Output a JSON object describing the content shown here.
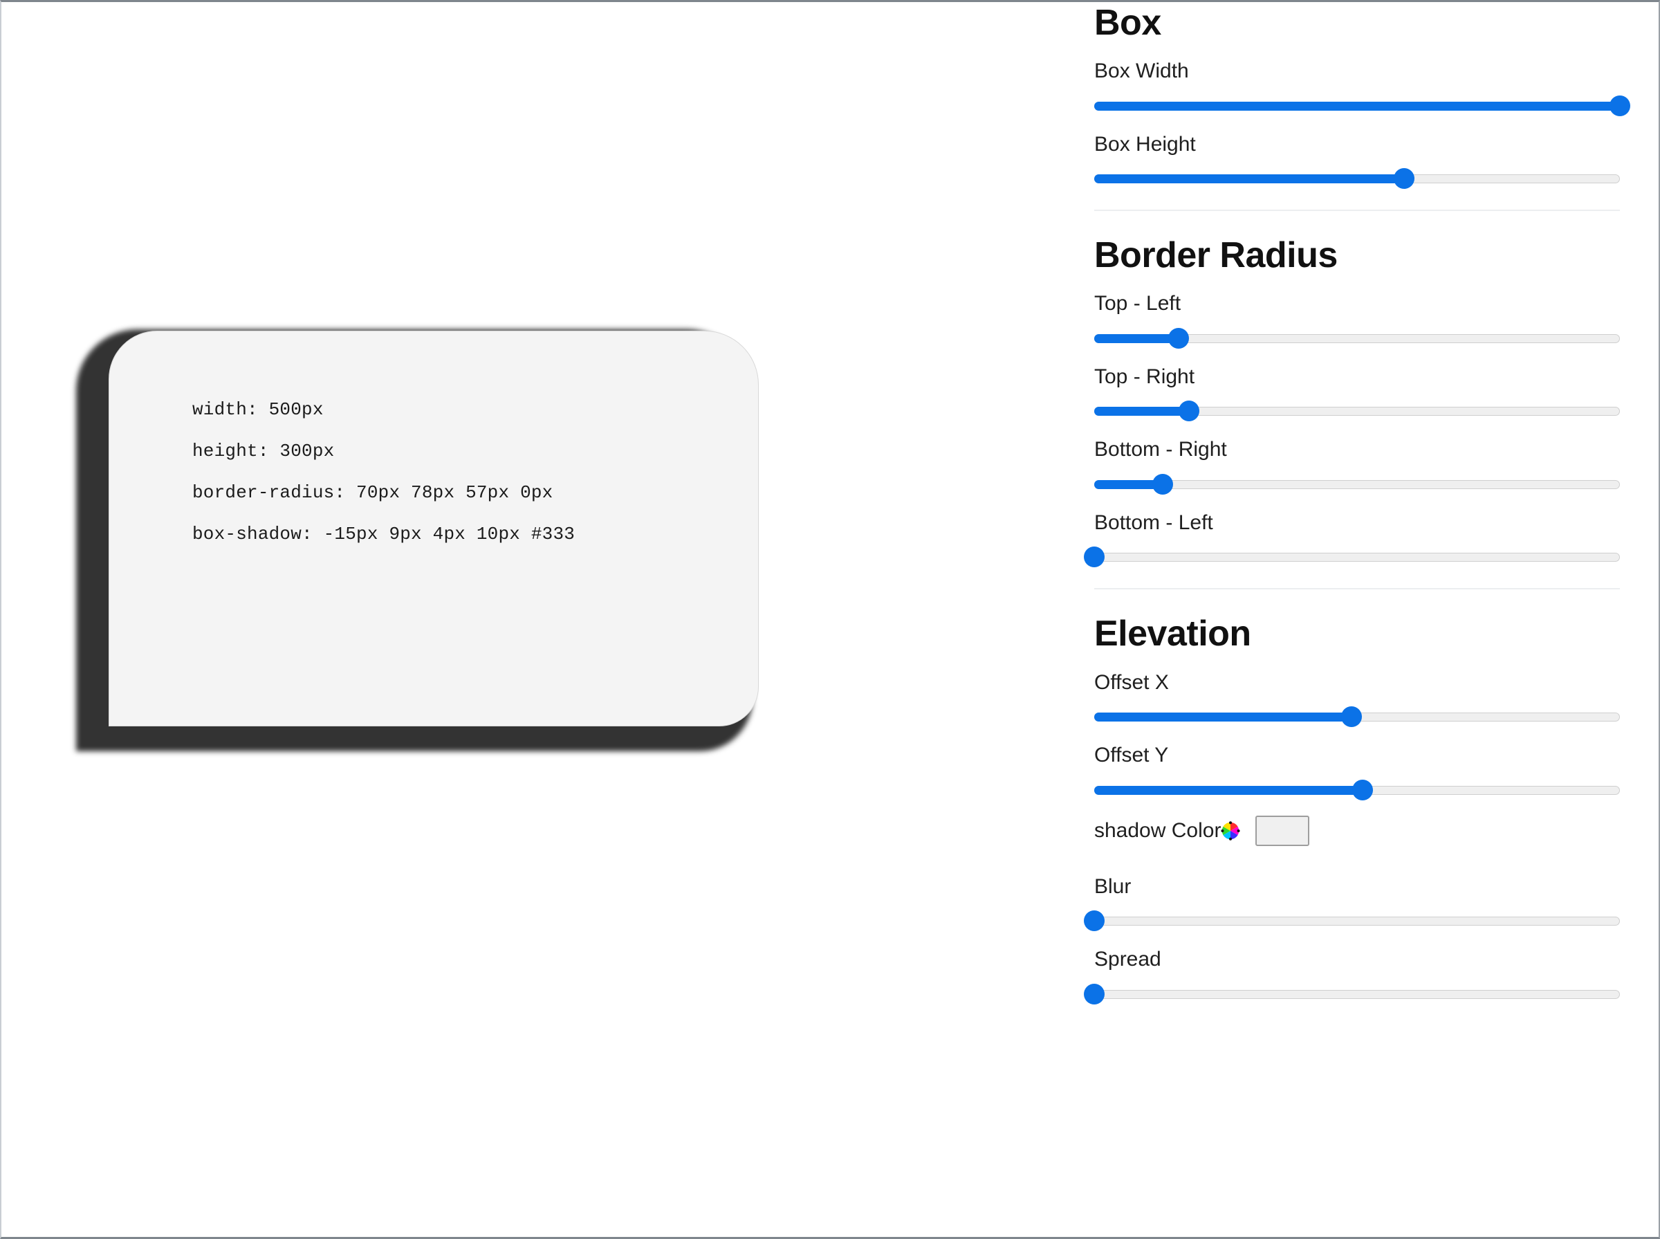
{
  "preview": {
    "code_lines": [
      "width: 500px",
      "height: 300px",
      "border-radius: 70px 78px 57px 0px",
      "box-shadow: -15px 9px 4px 10px #333"
    ],
    "box_background": "#f4f4f4",
    "shadow_color": "#333333"
  },
  "controls": {
    "accent_color": "#0b72e7",
    "track_color": "#efefef",
    "sections": [
      {
        "title": "Box",
        "fields": [
          {
            "label": "Box Width",
            "percent": 100,
            "kind": "slider"
          },
          {
            "label": "Box Height",
            "percent": 59,
            "kind": "slider"
          }
        ]
      },
      {
        "title": "Border Radius",
        "fields": [
          {
            "label": "Top - Left",
            "percent": 16,
            "kind": "slider"
          },
          {
            "label": "Top - Right",
            "percent": 18,
            "kind": "slider"
          },
          {
            "label": "Bottom - Right",
            "percent": 13,
            "kind": "slider"
          },
          {
            "label": "Bottom - Left",
            "percent": 0,
            "kind": "slider"
          }
        ]
      },
      {
        "title": "Elevation",
        "fields": [
          {
            "label": "Offset X",
            "percent": 49,
            "kind": "slider"
          },
          {
            "label": "Offset Y",
            "percent": 51,
            "kind": "slider"
          },
          {
            "label": "shadow Color",
            "kind": "color",
            "value": "#000000",
            "icon": "color-wheel-icon"
          },
          {
            "label": "Blur",
            "percent": 0,
            "kind": "slider"
          },
          {
            "label": "Spread",
            "percent": 0,
            "kind": "slider"
          }
        ]
      }
    ]
  }
}
